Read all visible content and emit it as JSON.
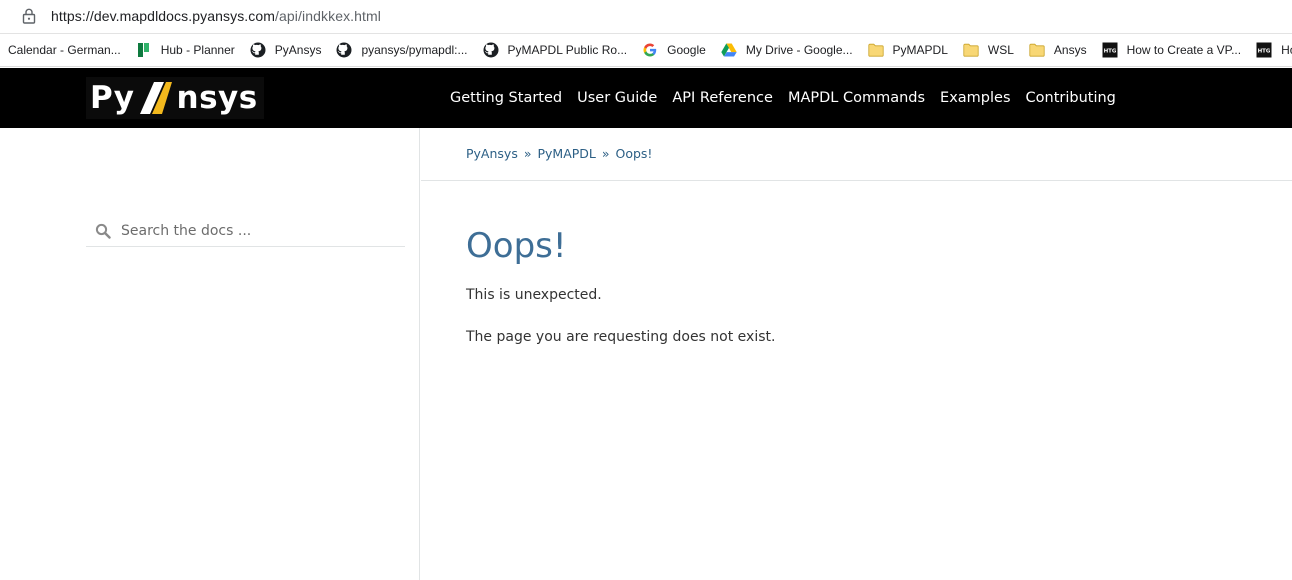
{
  "browser": {
    "url_host": "https://dev.mapdldocs.pyansys.com",
    "url_path": "/api/indkkex.html"
  },
  "bookmarks": [
    {
      "label": "Calendar - German...",
      "icon": "none"
    },
    {
      "label": "Hub - Planner",
      "icon": "planner-icon"
    },
    {
      "label": "PyAnsys",
      "icon": "github-icon"
    },
    {
      "label": "pyansys/pymapdl:...",
      "icon": "github-icon"
    },
    {
      "label": "PyMAPDL Public Ro...",
      "icon": "github-icon"
    },
    {
      "label": "Google",
      "icon": "google-icon"
    },
    {
      "label": "My Drive - Google...",
      "icon": "google-drive-icon"
    },
    {
      "label": "PyMAPDL",
      "icon": "folder-icon"
    },
    {
      "label": "WSL",
      "icon": "folder-icon"
    },
    {
      "label": "Ansys",
      "icon": "folder-icon"
    },
    {
      "label": "How to Create a VP...",
      "icon": "htg-icon"
    },
    {
      "label": "How to",
      "icon": "htg-icon"
    }
  ],
  "logo": {
    "left": "Py",
    "right": "nsys"
  },
  "nav": {
    "getting_started": "Getting Started",
    "user_guide": "User Guide",
    "api_reference": "API Reference",
    "mapdl_commands": "MAPDL Commands",
    "examples": "Examples",
    "contributing": "Contributing"
  },
  "search": {
    "placeholder": "Search the docs ..."
  },
  "breadcrumb": {
    "items": [
      "PyAnsys",
      "PyMAPDL",
      "Oops!"
    ],
    "separator": "»"
  },
  "content": {
    "title": "Oops!",
    "line1": "This is unexpected.",
    "line2": "The page you are requesting does not exist."
  },
  "colors": {
    "accent": "#f2b81d",
    "link": "#2c5f85",
    "title": "#3e6e96",
    "nav_bg": "#000000"
  }
}
